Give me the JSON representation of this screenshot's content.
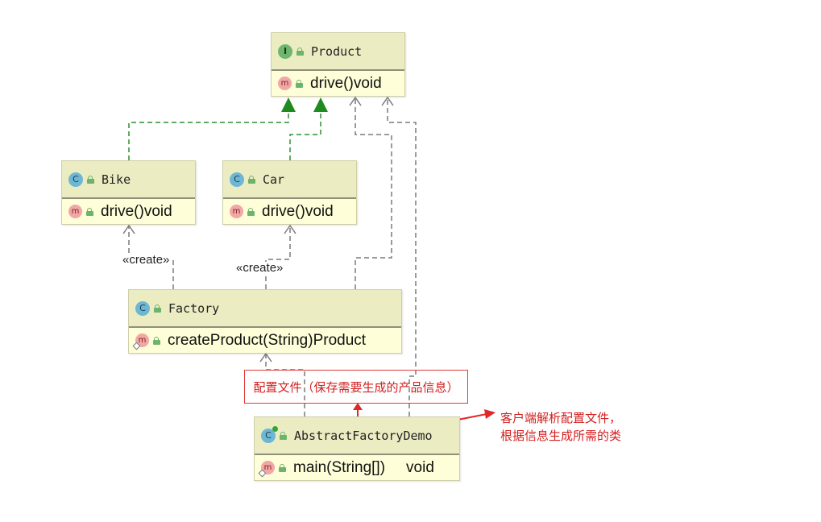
{
  "classes": {
    "product": {
      "kind": "I",
      "name": "Product",
      "method_kind": "m",
      "method": "drive()",
      "returns": "void"
    },
    "bike": {
      "kind": "C",
      "name": "Bike",
      "method_kind": "m",
      "method": "drive()",
      "returns": "void"
    },
    "car": {
      "kind": "C",
      "name": "Car",
      "method_kind": "m",
      "method": "drive()",
      "returns": "void"
    },
    "factory": {
      "kind": "C",
      "name": "Factory",
      "method_kind": "m",
      "method": "createProduct(String)",
      "returns": "Product"
    },
    "demo": {
      "kind": "C",
      "name": "AbstractFactoryDemo",
      "method_kind": "m",
      "method": "main(String[])",
      "returns": "void"
    }
  },
  "relations": {
    "create_bike": "«create»",
    "create_car": "«create»"
  },
  "note": {
    "text": "配置文件（保存需要生成的产品信息）"
  },
  "annotation": {
    "line1": "客户端解析配置文件，",
    "line2": "根据信息生成所需的类"
  },
  "colors": {
    "realization": "#2f8f2f",
    "dependency": "#7a7a7a",
    "annotation": "#e02828",
    "class_fill": "#fefed8",
    "class_header": "#ececc2"
  }
}
